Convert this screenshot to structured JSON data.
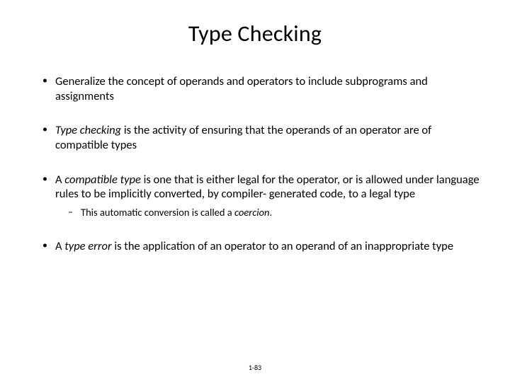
{
  "title": "Type Checking",
  "bullet1": "Generalize the concept of operands and operators to include subprograms and assignments",
  "bullet2_em": "Type checking",
  "bullet2_rest": " is the activity of ensuring that the operands of an operator are of compatible types",
  "bullet3_pre": "A ",
  "bullet3_em": "compatible type",
  "bullet3_rest": " is one that is either legal for the operator, or is allowed under language rules to be implicitly converted, by compiler- generated code, to a legal type",
  "bullet3_sub_pre": "This automatic conversion is called a ",
  "bullet3_sub_em": "coercion",
  "bullet3_sub_post": ".",
  "bullet4_pre": "A ",
  "bullet4_em": "type error",
  "bullet4_rest": " is the application of an operator to an operand of an inappropriate type",
  "footer": "1-83"
}
